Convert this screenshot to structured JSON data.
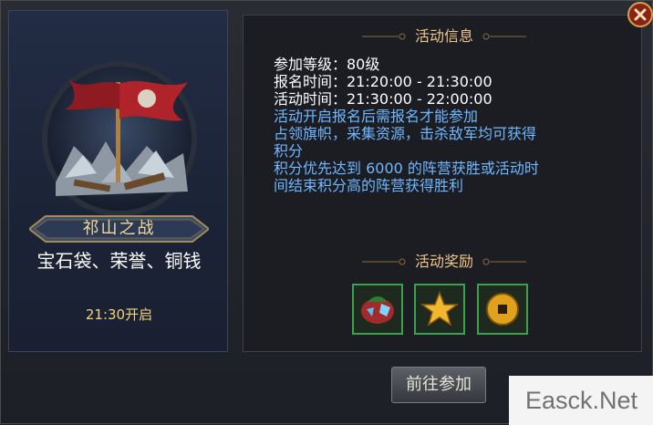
{
  "event": {
    "name": "祁山之战",
    "rewards_summary": "宝石袋、荣誉、铜钱",
    "start_time": "21:30开启"
  },
  "info_section": {
    "title": "活动信息",
    "lines": [
      {
        "text": "参加等级：80级",
        "color": "#ffffff"
      },
      {
        "text": "报名时间：21:20:00 - 21:30:00",
        "color": "#ffffff"
      },
      {
        "text": "活动时间：21:30:00 - 22:00:00",
        "color": "#ffffff"
      },
      {
        "text": "活动开启报名后需报名才能参加",
        "color": "#6fb7ff"
      },
      {
        "text": "占领旗帜，采集资源，击杀敌军均可获得",
        "color": "#6fb7ff"
      },
      {
        "text": "积分",
        "color": "#6fb7ff"
      },
      {
        "text": "积分优先达到 6000 的阵营获胜或活动时",
        "color": "#6fb7ff"
      },
      {
        "text": "间结束积分高的阵营获得胜利",
        "color": "#6fb7ff"
      }
    ]
  },
  "reward_section": {
    "title": "活动奖励",
    "items": [
      {
        "icon": "gem-bag-icon"
      },
      {
        "icon": "star-honor-icon"
      },
      {
        "icon": "copper-coin-icon"
      }
    ]
  },
  "buttons": {
    "join": "前往参加",
    "close_icon": "close-icon"
  },
  "watermark": "Easck.Net"
}
